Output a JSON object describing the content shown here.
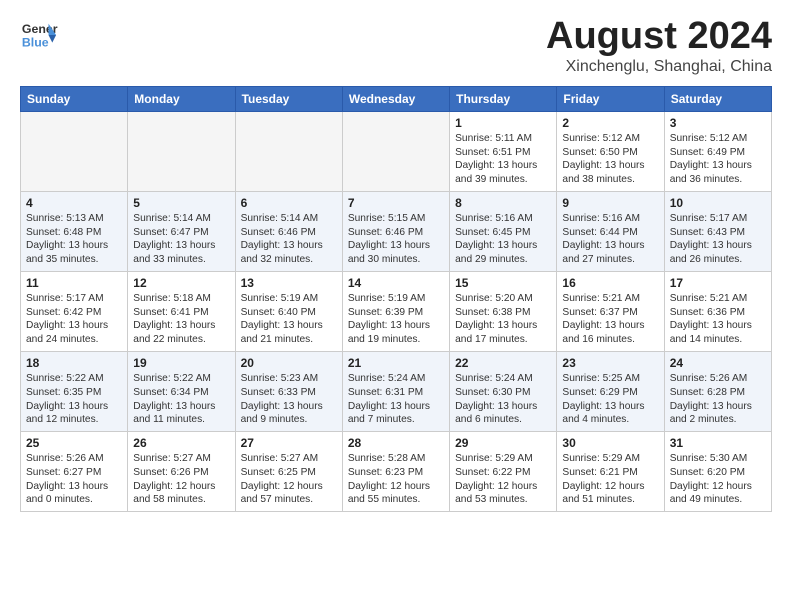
{
  "header": {
    "logo_general": "General",
    "logo_blue": "Blue",
    "main_title": "August 2024",
    "subtitle": "Xinchenglu, Shanghai, China"
  },
  "weekdays": [
    "Sunday",
    "Monday",
    "Tuesday",
    "Wednesday",
    "Thursday",
    "Friday",
    "Saturday"
  ],
  "weeks": [
    [
      {
        "day": "",
        "info": ""
      },
      {
        "day": "",
        "info": ""
      },
      {
        "day": "",
        "info": ""
      },
      {
        "day": "",
        "info": ""
      },
      {
        "day": "1",
        "info": "Sunrise: 5:11 AM\nSunset: 6:51 PM\nDaylight: 13 hours\nand 39 minutes."
      },
      {
        "day": "2",
        "info": "Sunrise: 5:12 AM\nSunset: 6:50 PM\nDaylight: 13 hours\nand 38 minutes."
      },
      {
        "day": "3",
        "info": "Sunrise: 5:12 AM\nSunset: 6:49 PM\nDaylight: 13 hours\nand 36 minutes."
      }
    ],
    [
      {
        "day": "4",
        "info": "Sunrise: 5:13 AM\nSunset: 6:48 PM\nDaylight: 13 hours\nand 35 minutes."
      },
      {
        "day": "5",
        "info": "Sunrise: 5:14 AM\nSunset: 6:47 PM\nDaylight: 13 hours\nand 33 minutes."
      },
      {
        "day": "6",
        "info": "Sunrise: 5:14 AM\nSunset: 6:46 PM\nDaylight: 13 hours\nand 32 minutes."
      },
      {
        "day": "7",
        "info": "Sunrise: 5:15 AM\nSunset: 6:46 PM\nDaylight: 13 hours\nand 30 minutes."
      },
      {
        "day": "8",
        "info": "Sunrise: 5:16 AM\nSunset: 6:45 PM\nDaylight: 13 hours\nand 29 minutes."
      },
      {
        "day": "9",
        "info": "Sunrise: 5:16 AM\nSunset: 6:44 PM\nDaylight: 13 hours\nand 27 minutes."
      },
      {
        "day": "10",
        "info": "Sunrise: 5:17 AM\nSunset: 6:43 PM\nDaylight: 13 hours\nand 26 minutes."
      }
    ],
    [
      {
        "day": "11",
        "info": "Sunrise: 5:17 AM\nSunset: 6:42 PM\nDaylight: 13 hours\nand 24 minutes."
      },
      {
        "day": "12",
        "info": "Sunrise: 5:18 AM\nSunset: 6:41 PM\nDaylight: 13 hours\nand 22 minutes."
      },
      {
        "day": "13",
        "info": "Sunrise: 5:19 AM\nSunset: 6:40 PM\nDaylight: 13 hours\nand 21 minutes."
      },
      {
        "day": "14",
        "info": "Sunrise: 5:19 AM\nSunset: 6:39 PM\nDaylight: 13 hours\nand 19 minutes."
      },
      {
        "day": "15",
        "info": "Sunrise: 5:20 AM\nSunset: 6:38 PM\nDaylight: 13 hours\nand 17 minutes."
      },
      {
        "day": "16",
        "info": "Sunrise: 5:21 AM\nSunset: 6:37 PM\nDaylight: 13 hours\nand 16 minutes."
      },
      {
        "day": "17",
        "info": "Sunrise: 5:21 AM\nSunset: 6:36 PM\nDaylight: 13 hours\nand 14 minutes."
      }
    ],
    [
      {
        "day": "18",
        "info": "Sunrise: 5:22 AM\nSunset: 6:35 PM\nDaylight: 13 hours\nand 12 minutes."
      },
      {
        "day": "19",
        "info": "Sunrise: 5:22 AM\nSunset: 6:34 PM\nDaylight: 13 hours\nand 11 minutes."
      },
      {
        "day": "20",
        "info": "Sunrise: 5:23 AM\nSunset: 6:33 PM\nDaylight: 13 hours\nand 9 minutes."
      },
      {
        "day": "21",
        "info": "Sunrise: 5:24 AM\nSunset: 6:31 PM\nDaylight: 13 hours\nand 7 minutes."
      },
      {
        "day": "22",
        "info": "Sunrise: 5:24 AM\nSunset: 6:30 PM\nDaylight: 13 hours\nand 6 minutes."
      },
      {
        "day": "23",
        "info": "Sunrise: 5:25 AM\nSunset: 6:29 PM\nDaylight: 13 hours\nand 4 minutes."
      },
      {
        "day": "24",
        "info": "Sunrise: 5:26 AM\nSunset: 6:28 PM\nDaylight: 13 hours\nand 2 minutes."
      }
    ],
    [
      {
        "day": "25",
        "info": "Sunrise: 5:26 AM\nSunset: 6:27 PM\nDaylight: 13 hours\nand 0 minutes."
      },
      {
        "day": "26",
        "info": "Sunrise: 5:27 AM\nSunset: 6:26 PM\nDaylight: 12 hours\nand 58 minutes."
      },
      {
        "day": "27",
        "info": "Sunrise: 5:27 AM\nSunset: 6:25 PM\nDaylight: 12 hours\nand 57 minutes."
      },
      {
        "day": "28",
        "info": "Sunrise: 5:28 AM\nSunset: 6:23 PM\nDaylight: 12 hours\nand 55 minutes."
      },
      {
        "day": "29",
        "info": "Sunrise: 5:29 AM\nSunset: 6:22 PM\nDaylight: 12 hours\nand 53 minutes."
      },
      {
        "day": "30",
        "info": "Sunrise: 5:29 AM\nSunset: 6:21 PM\nDaylight: 12 hours\nand 51 minutes."
      },
      {
        "day": "31",
        "info": "Sunrise: 5:30 AM\nSunset: 6:20 PM\nDaylight: 12 hours\nand 49 minutes."
      }
    ]
  ]
}
